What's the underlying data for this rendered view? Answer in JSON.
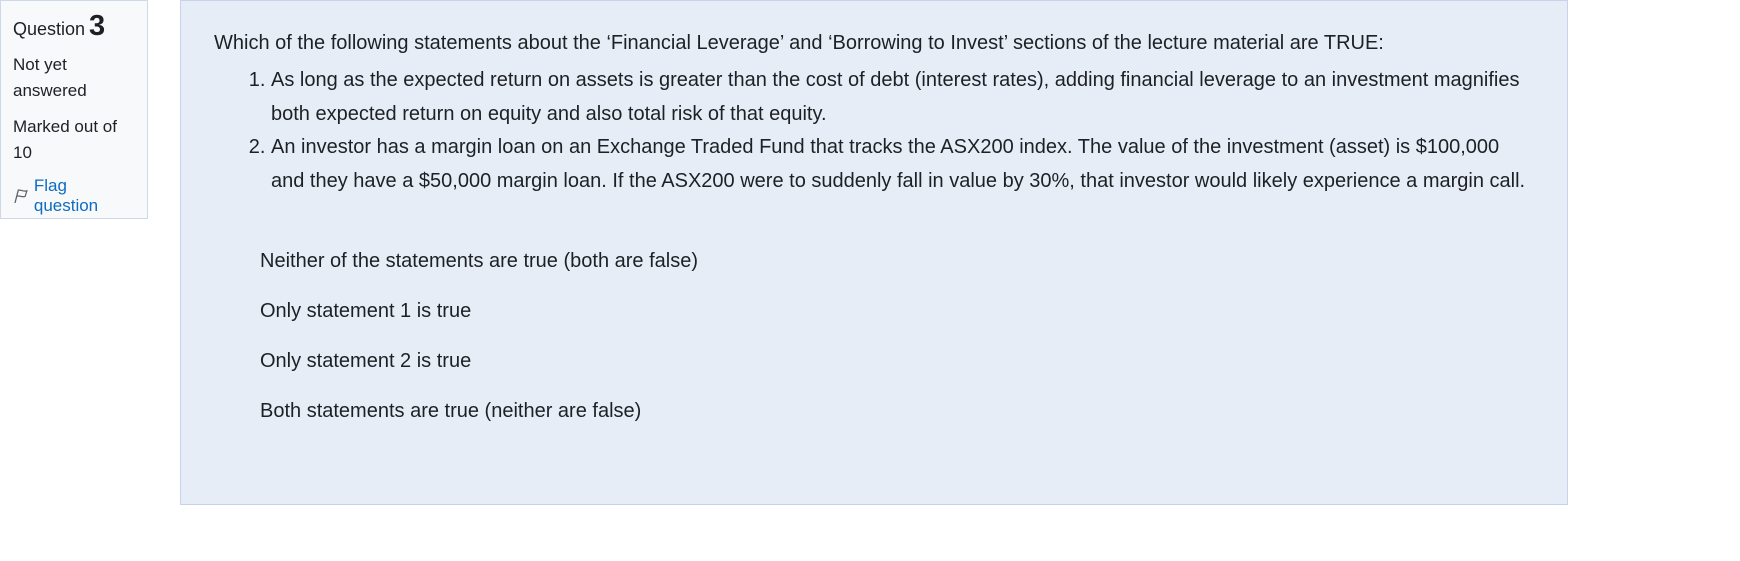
{
  "info": {
    "question_label": "Question",
    "question_number": "3",
    "state": "Not yet answered",
    "grade": "Marked out of 10",
    "flag_label": "Flag question"
  },
  "question": {
    "text": "Which of the following statements about the ‘Financial Leverage’ and ‘Borrowing to Invest’ sections of the lecture material are TRUE:",
    "statements": [
      "As long as the expected return on assets is greater than the cost of debt (interest rates), adding financial leverage to an investment magnifies both expected return on equity and also total risk of that equity.",
      "An investor has a margin loan on an Exchange Traded Fund that tracks the ASX200 index. The value of the investment (asset) is $100,000 and they have a $50,000 margin loan. If the ASX200 were to suddenly fall in value by 30%, that investor would likely experience a margin call."
    ],
    "answers": [
      "Neither of the statements are true (both are false)",
      "Only statement 1 is true",
      "Only statement 2 is true",
      "Both statements are true (neither are false)"
    ]
  },
  "colors": {
    "content_bg": "#e7edf7",
    "info_bg": "#f8f9fa",
    "link": "#0f6cbf"
  },
  "icons": {
    "flag": "flag-icon"
  }
}
